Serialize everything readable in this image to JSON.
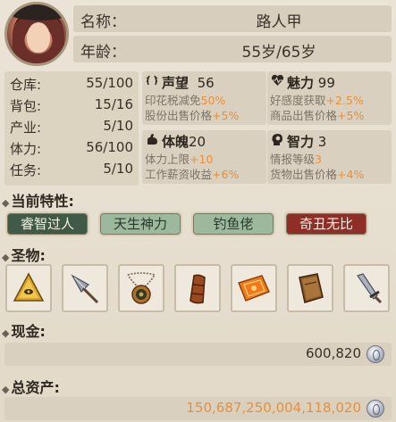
{
  "character": {
    "name_label": "名称：",
    "name": "路人甲",
    "age_label": "年龄：",
    "age": "55岁/65岁"
  },
  "stats": [
    {
      "label": "仓库:",
      "value": "55/100"
    },
    {
      "label": "背包:",
      "value": "15/16"
    },
    {
      "label": "产业:",
      "value": "5/10"
    },
    {
      "label": "体力:",
      "value": "56/100"
    },
    {
      "label": "任务:",
      "value": "5/10"
    }
  ],
  "attributes": {
    "reputation": {
      "icon": "laurel-icon",
      "name": "声望",
      "value": "56",
      "lines": [
        {
          "text": "印花税减免",
          "bonus": "50%"
        },
        {
          "text": "股份出售价格",
          "bonus": "+5%"
        }
      ]
    },
    "charm": {
      "icon": "heart-pulse-icon",
      "name": "魅力",
      "value": "99",
      "lines": [
        {
          "text": "好感度获取",
          "bonus": "+2.5%"
        },
        {
          "text": "商品出售价格",
          "bonus": "+5%"
        }
      ]
    },
    "physique": {
      "icon": "flexed-arm-icon",
      "name": "体魄",
      "value": "20",
      "lines": [
        {
          "text": "体力上限",
          "bonus": "+10"
        },
        {
          "text": "工作薪资收益",
          "bonus": "+6%"
        }
      ]
    },
    "intellect": {
      "icon": "brain-head-icon",
      "name": "智力",
      "value": "3",
      "lines": [
        {
          "text": "情报等级",
          "bonus": "3"
        },
        {
          "text": "货物出售价格",
          "bonus": "+4%"
        }
      ]
    }
  },
  "traits_section": {
    "title": "当前特性:"
  },
  "traits": [
    "睿智过人",
    "天生神力",
    "钓鱼佬",
    "奇丑无比"
  ],
  "relics_section": {
    "title": "圣物:"
  },
  "relics": [
    "pyramid-eye-relic-icon",
    "spear-head-relic-icon",
    "amulet-relic-icon",
    "leather-bracer-relic-icon",
    "orange-cloth-relic-icon",
    "old-book-relic-icon",
    "broken-sword-relic-icon"
  ],
  "cash": {
    "title": "现金:",
    "amount": "600,820"
  },
  "assets": {
    "title": "总资产:",
    "amount": "150,687,250,004,118,020"
  },
  "colors": {
    "bonus": "#e7903a",
    "trait_dark_green": "#3f5a47",
    "trait_light_green": "#9cb99e",
    "trait_red": "#8f2e26"
  }
}
